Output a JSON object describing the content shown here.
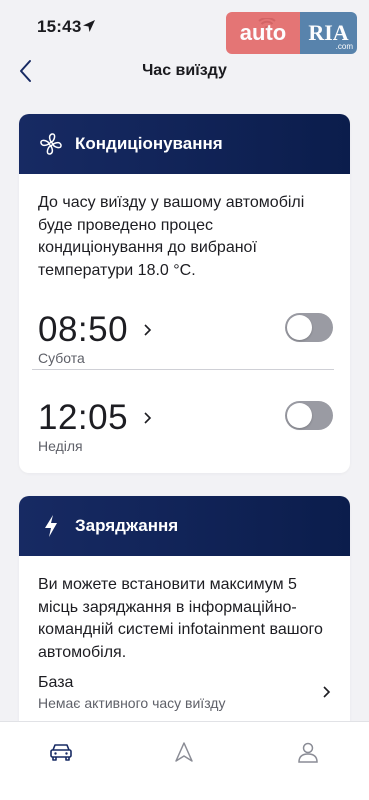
{
  "status_bar": {
    "time": "15:43",
    "icons": [
      "location-arrow-icon",
      "cellular-icon",
      "wifi-icon",
      "battery-icon"
    ]
  },
  "watermark": {
    "left": "auto",
    "right": "RIA",
    "suffix": ".com"
  },
  "nav": {
    "title": "Час виїзду",
    "back_icon": "chevron-left-icon"
  },
  "climate": {
    "title": "Кондиціонування",
    "icon": "fan-icon",
    "description": "До часу виїзду у вашому автомобілі буде проведено процес кондиціонування до вибраної температури  18.0 °C.",
    "timers": [
      {
        "time": "08:50",
        "day": "Субота",
        "enabled": false
      },
      {
        "time": "12:05",
        "day": "Неділя",
        "enabled": false
      }
    ]
  },
  "charging": {
    "title": "Заряджання",
    "icon": "lightning-icon",
    "description": "Ви можете встановити максимум 5 місць заряджання в інформаційно-командній системі infotainment вашого автомобіля.",
    "location": {
      "title": "База",
      "subtitle": "Немає активного часу виїзду"
    }
  },
  "tabs": [
    {
      "name": "car",
      "icon": "car-icon",
      "active": true
    },
    {
      "name": "navigation",
      "icon": "navigation-arrow-icon",
      "active": false
    },
    {
      "name": "profile",
      "icon": "person-icon",
      "active": false
    }
  ],
  "colors": {
    "header_bg": "#0b1d4c",
    "accent": "#172a63",
    "toggle_off": "#9a9ba3",
    "background": "#f2f2f5"
  }
}
